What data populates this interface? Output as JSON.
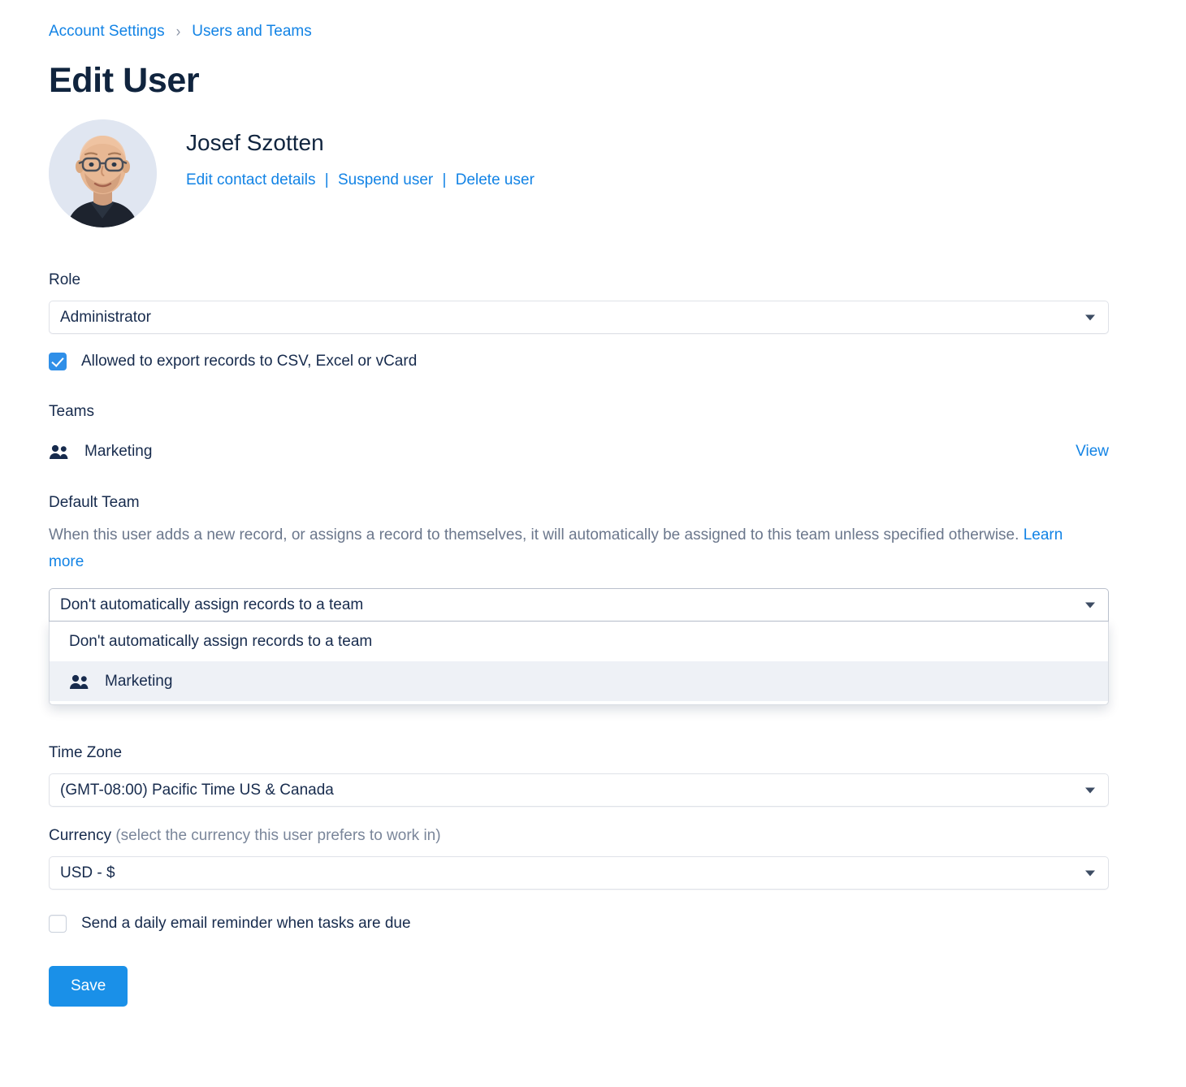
{
  "breadcrumb": {
    "items": [
      {
        "label": "Account Settings"
      },
      {
        "label": "Users and Teams"
      }
    ],
    "separator": "›"
  },
  "page_title": "Edit User",
  "user": {
    "name": "Josef Szotten",
    "avatar_icon": "user-avatar-photo",
    "actions": [
      {
        "label": "Edit contact details"
      },
      {
        "label": "Suspend user"
      },
      {
        "label": "Delete user"
      }
    ],
    "separator": "|"
  },
  "role": {
    "label": "Role",
    "value": "Administrator",
    "caret_icon": "chevron-down-icon"
  },
  "export_permission": {
    "label": "Allowed to export records to CSV, Excel or vCard",
    "checked": true
  },
  "teams": {
    "label": "Teams",
    "rows": [
      {
        "name": "Marketing",
        "icon": "users-icon",
        "action_label": "View"
      }
    ]
  },
  "default_team": {
    "label": "Default Team",
    "description": "When this user adds a new record, or assigns a record to themselves, it will automatically be assigned to this team unless specified otherwise.",
    "learn_more_label": "Learn more",
    "value": "Don't automatically assign records to a team",
    "caret_icon": "chevron-down-icon",
    "open": true,
    "options": [
      {
        "label": "Don't automatically assign records to a team",
        "icon": null,
        "highlighted": false
      },
      {
        "label": "Marketing",
        "icon": "users-icon",
        "highlighted": true
      }
    ]
  },
  "time_zone": {
    "label": "Time Zone",
    "value": "(GMT-08:00) Pacific Time US & Canada",
    "caret_icon": "chevron-down-icon"
  },
  "currency": {
    "label": "Currency",
    "hint": "(select the currency this user prefers to work in)",
    "value": "USD - $",
    "caret_icon": "chevron-down-icon"
  },
  "email_reminder": {
    "label": "Send a daily email reminder when tasks are due",
    "checked": false
  },
  "save_button": {
    "label": "Save"
  },
  "colors": {
    "link_blue": "#1283e5",
    "primary_button": "#1a90e8",
    "checkbox_checked": "#2f8fe8",
    "text": "#172b4d",
    "muted_text": "#6b778c",
    "border": "#dfe2e8",
    "option_highlight": "#eef1f6"
  }
}
